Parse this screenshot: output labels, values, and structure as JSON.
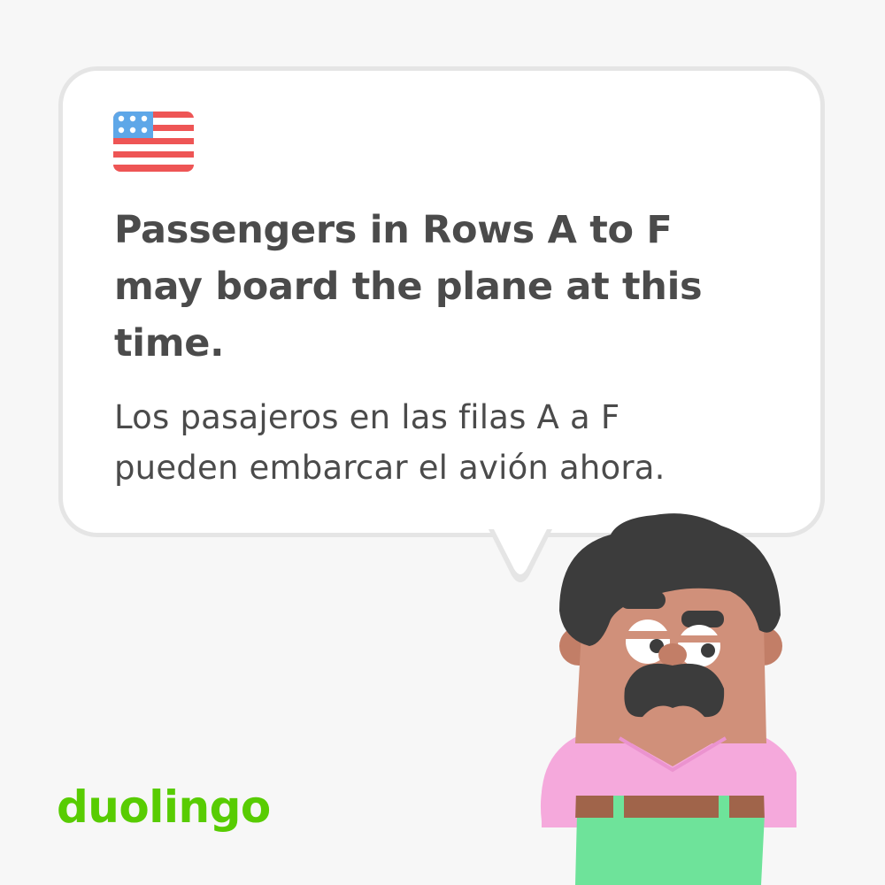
{
  "card": {
    "flag_icon": "us-flag-icon",
    "english_text": "Passengers in Rows A to F may board the plane at this time.",
    "spanish_text": "Los pasajeros en las filas A a F pueden embarcar el avión ahora."
  },
  "brand": {
    "logo_text": "duolingo",
    "logo_color": "#58cc02"
  },
  "character": {
    "icon": "mustached-man-character",
    "shirt_color": "#f5a9dc",
    "pants_color": "#6ee39a",
    "skin_color": "#d0907a",
    "hair_color": "#3c3c3c"
  },
  "colors": {
    "background": "#f7f7f7",
    "bubble": "#ffffff",
    "bubble_border": "#e5e5e5",
    "text": "#4b4b4b"
  }
}
